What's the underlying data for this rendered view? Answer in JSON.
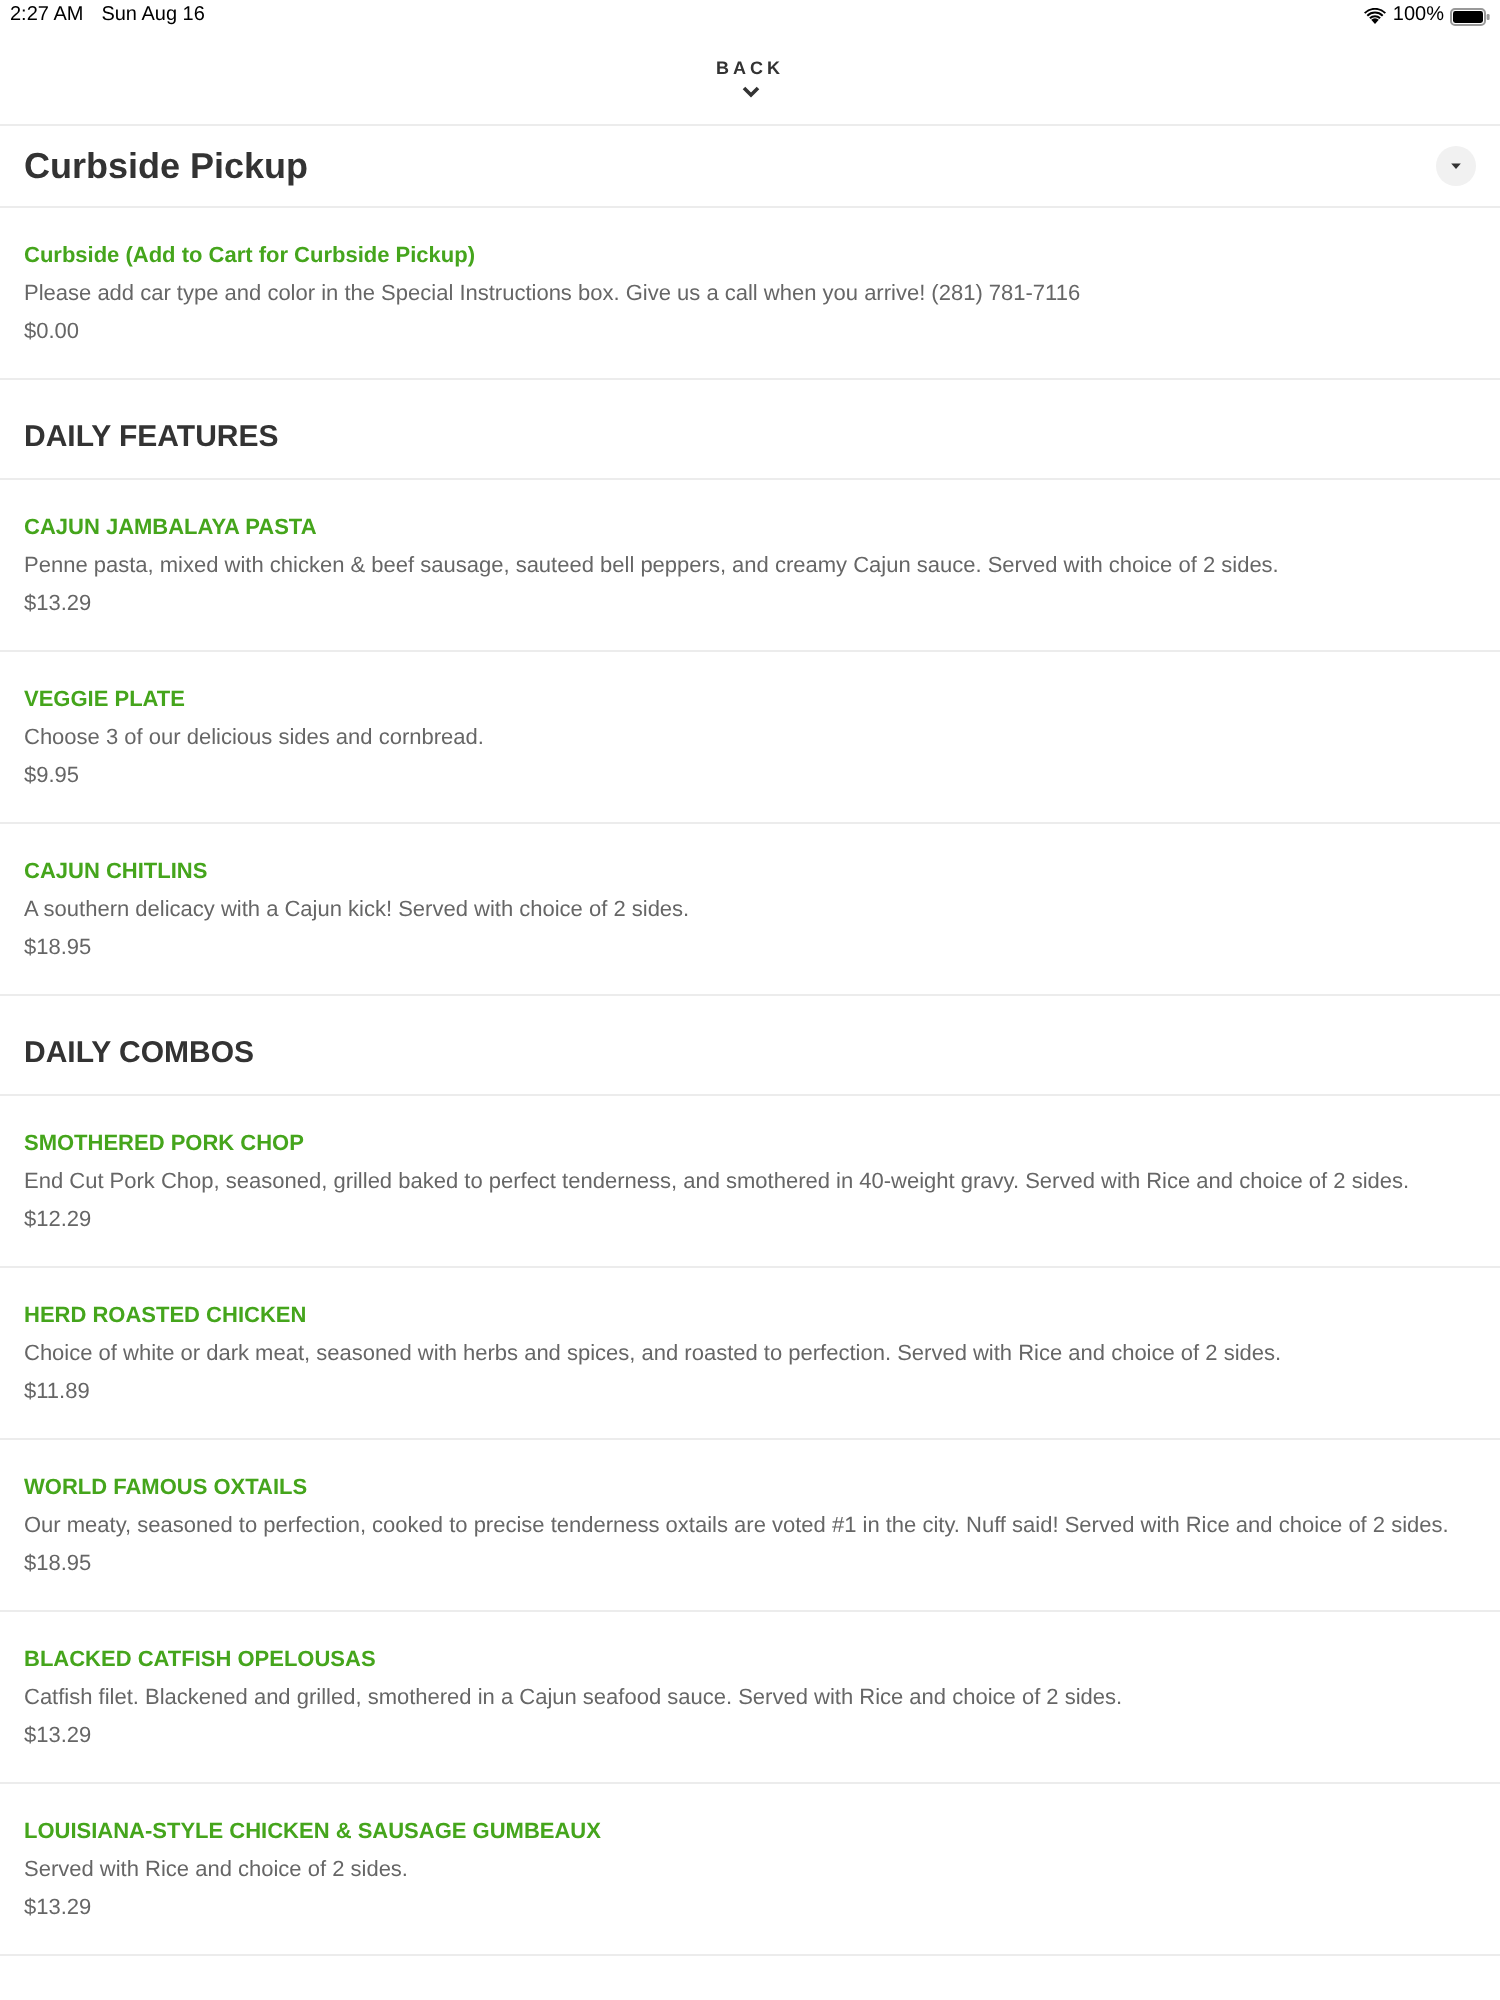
{
  "status_bar": {
    "time": "2:27 AM",
    "date": "Sun Aug 16",
    "battery": "100%"
  },
  "back": {
    "label": "BACK"
  },
  "sections": [
    {
      "kind": "category",
      "title": "Curbside Pickup",
      "items": [
        {
          "name": "Curbside (Add to Cart for Curbside Pickup)",
          "description": "Please add car type and color in the Special Instructions box. Give us a call when you arrive! (281) 781-7116",
          "price": "$0.00"
        }
      ]
    },
    {
      "kind": "group",
      "title": "DAILY FEATURES",
      "items": [
        {
          "name": "CAJUN JAMBALAYA PASTA",
          "description": "Penne pasta, mixed with chicken & beef sausage, sauteed bell peppers, and creamy Cajun sauce. Served with choice of 2 sides.",
          "price": "$13.29"
        },
        {
          "name": "VEGGIE PLATE",
          "description": "Choose 3 of our delicious sides and cornbread.",
          "price": "$9.95"
        },
        {
          "name": "CAJUN CHITLINS",
          "description": "A southern delicacy with a Cajun kick! Served with choice of 2 sides.",
          "price": "$18.95"
        }
      ]
    },
    {
      "kind": "group",
      "title": "DAILY COMBOS",
      "items": [
        {
          "name": "SMOTHERED PORK CHOP",
          "description": "End Cut Pork Chop, seasoned, grilled baked to perfect tenderness, and smothered in 40-weight gravy. Served with Rice and choice of 2 sides.",
          "price": "$12.29"
        },
        {
          "name": "HERD ROASTED CHICKEN",
          "description": "Choice of white or dark meat, seasoned with herbs and spices, and roasted to perfection. Served with Rice and choice of 2 sides.",
          "price": "$11.89"
        },
        {
          "name": "WORLD FAMOUS OXTAILS",
          "description": "Our meaty, seasoned to perfection, cooked to precise tenderness oxtails are voted #1 in the city. Nuff said! Served with Rice and choice of 2 sides.",
          "price": "$18.95"
        },
        {
          "name": "BLACKED CATFISH OPELOUSAS",
          "description": "Catfish filet. Blackened and grilled, smothered in a Cajun seafood sauce. Served with Rice and choice of 2 sides.",
          "price": "$13.29"
        },
        {
          "name": "LOUISIANA-STYLE CHICKEN & SAUSAGE GUMBEAUX",
          "description": "Served with Rice and choice of 2 sides.",
          "price": "$13.29"
        }
      ]
    }
  ]
}
